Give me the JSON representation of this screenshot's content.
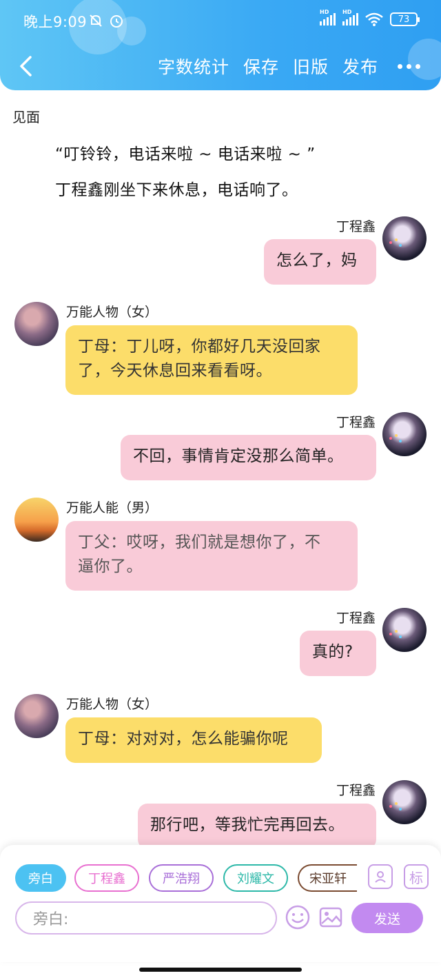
{
  "status_bar": {
    "time": "晚上9:09",
    "hd1": "HD",
    "hd2": "HD",
    "battery": "73"
  },
  "toolbar": {
    "word_count": "字数统计",
    "save": "保存",
    "old_version": "旧版",
    "publish": "发布"
  },
  "chapter": {
    "title": "见面"
  },
  "narration": [
    "“叮铃铃，电话来啦 ~ 电话来啦 ~ ”",
    "丁程鑫刚坐下来休息，电话响了。"
  ],
  "messages": [
    {
      "speaker": "丁程鑫",
      "text": "怎么了，妈"
    },
    {
      "speaker": "万能人物（女）",
      "text_line1": "丁母：丁儿呀，你都好几天没回家",
      "text_line2": "了，今天休息回来看看呀。"
    },
    {
      "speaker": "丁程鑫",
      "text": "不回，事情肯定没那么简单。"
    },
    {
      "speaker": "万能人能（男）",
      "text_line1": "丁父：哎呀，我们就是想你了，不",
      "text_line2": "逼你了。"
    },
    {
      "speaker": "丁程鑫",
      "text": "真的?"
    },
    {
      "speaker": "万能人物（女）",
      "text": "丁母：对对对，怎么能骗你呢"
    },
    {
      "speaker": "丁程鑫",
      "text": "那行吧，等我忙完再回去。"
    }
  ],
  "roles": [
    {
      "label": "旁白",
      "color": "#4cc2f2"
    },
    {
      "label": "丁程鑫",
      "color": "#e86fd0"
    },
    {
      "label": "严浩翔",
      "color": "#a86ed8"
    },
    {
      "label": "刘耀文",
      "color": "#2cb8a8"
    },
    {
      "label": "宋亚轩",
      "color": "#7a4a30"
    }
  ],
  "tag_button": "标",
  "input": {
    "placeholder": "旁白:"
  },
  "send": "发送",
  "colors": {
    "header": "#3aa9f4",
    "bubble_pink": "#f9cbd8",
    "bubble_yellow": "#fcdd6a",
    "send_purple": "#c28af0"
  }
}
